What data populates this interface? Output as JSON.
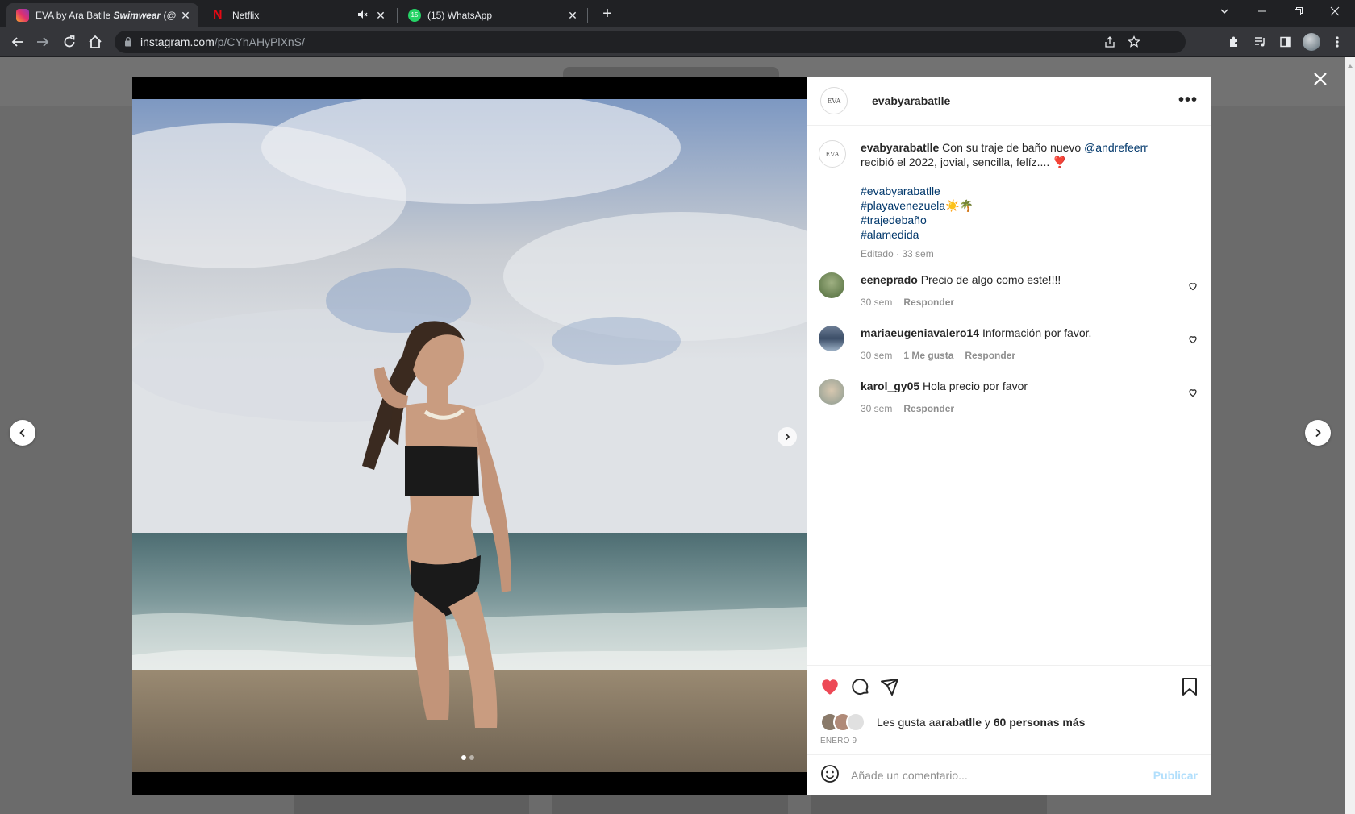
{
  "browser": {
    "tabs": [
      {
        "title": "EVA by Ara Batlle ",
        "title_bold": "Swimwear",
        "title_tail": " (@",
        "close": "✕"
      },
      {
        "title": "Netflix",
        "close": "✕"
      },
      {
        "title": "(15) WhatsApp",
        "badge": "15",
        "close": "✕"
      }
    ],
    "new_tab": "+",
    "url_host": "instagram.com",
    "url_path": "/p/CYhAHyPlXnS/"
  },
  "post": {
    "username": "evabyarabatlle",
    "avatar_text": "EVA",
    "more": "•••",
    "caption": {
      "user": "evabyarabatlle",
      "text1": " Con su traje de baño nuevo ",
      "mention": "@andrefeerr",
      "text2": " recibió el 2022, jovial, sencilla, felíz.... ❣️",
      "hashtags": [
        "#evabyarabatlle",
        "#playavenezuela☀️🌴",
        "#trajedebaño",
        "#alamedida"
      ],
      "meta": "Editado · 33 sem"
    },
    "comments": [
      {
        "user": "eeneprado",
        "text": " Precio de algo como este!!!!",
        "time": "30 sem",
        "likes": "",
        "reply": "Responder"
      },
      {
        "user": "mariaeugeniavalero14",
        "text": " Información por favor.",
        "time": "30 sem",
        "likes": "1 Me gusta",
        "reply": "Responder"
      },
      {
        "user": "karol_gy05",
        "text": " Hola precio por favor",
        "time": "30 sem",
        "likes": "",
        "reply": "Responder"
      }
    ],
    "likes": {
      "prefix": "Les gusta a ",
      "user": "arabatlle",
      "mid": " y ",
      "others": "60 personas más"
    },
    "date": "ENERO 9",
    "add_comment_placeholder": "Añade un comentario...",
    "publish": "Publicar",
    "carousel": {
      "count": 2,
      "current": 1
    }
  }
}
